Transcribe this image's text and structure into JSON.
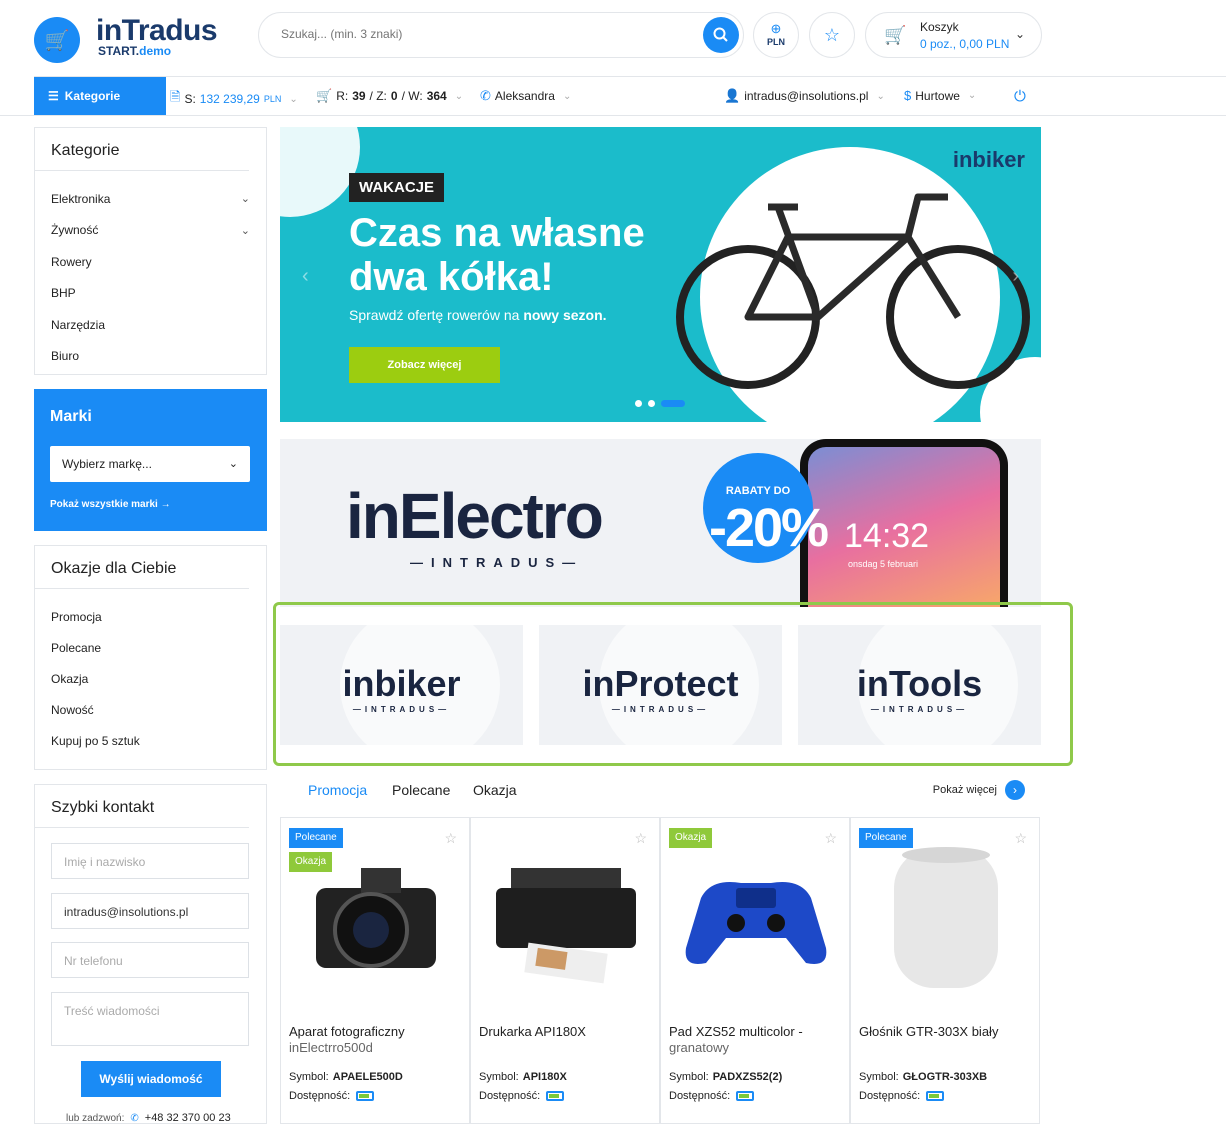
{
  "header": {
    "logo_main": "inTradus",
    "logo_sub_a": "START.",
    "logo_sub_b": "demo",
    "search_placeholder": "Szukaj... (min. 3 znaki)",
    "currency_label": "PLN",
    "cart": {
      "title": "Koszyk",
      "summary": "0 poz., 0,00 PLN"
    }
  },
  "subnav": {
    "categories_label": "Kategorie",
    "balance_prefix": "S:",
    "balance_value": "132 239,29",
    "balance_currency": "PLN",
    "orders_r": "R:",
    "orders_r_val": "39",
    "orders_z": " / Z:",
    "orders_z_val": "0",
    "orders_w": " / W:",
    "orders_w_val": "364",
    "user": "Aleksandra",
    "email": "intradus@insolutions.pl",
    "price_type": "Hurtowe"
  },
  "sidebar": {
    "categories_title": "Kategorie",
    "categories": [
      {
        "label": "Elektronika",
        "has_children": true
      },
      {
        "label": "Żywność",
        "has_children": true
      },
      {
        "label": "Rowery"
      },
      {
        "label": "BHP"
      },
      {
        "label": "Narzędzia"
      },
      {
        "label": "Biuro"
      }
    ],
    "brands_title": "Marki",
    "brands_select": "Wybierz markę...",
    "brands_all": "Pokaż wszystkie marki",
    "deals_title": "Okazje dla Ciebie",
    "deals": [
      "Promocja",
      "Polecane",
      "Okazja",
      "Nowość",
      "Kupuj po 5 sztuk"
    ],
    "contact_title": "Szybki kontakt",
    "contact_name_placeholder": "Imię i nazwisko",
    "contact_email_value": "intradus@insolutions.pl",
    "contact_phone_placeholder": "Nr telefonu",
    "contact_message_placeholder": "Treść wiadomości",
    "contact_send": "Wyślij wiadomość",
    "call_label": "lub zadzwoń:",
    "call_number": "+48 32 370 00 23"
  },
  "slider": {
    "tag": "WAKACJE",
    "headline_1": "Czas na własne",
    "headline_2": "dwa kółka!",
    "sub_a": "Sprawdź ofertę rowerów na ",
    "sub_b": "nowy sezon.",
    "button": "Zobacz więcej",
    "brand": "inbiker"
  },
  "electro": {
    "logo": "inElectro",
    "sub": "—INTRADUS—",
    "promo_top": "RABATY DO",
    "promo_value": "-20%",
    "phone_time": "14:32",
    "phone_date": "onsdag 5 februari"
  },
  "brand_tiles": [
    {
      "name": "inbiker",
      "sub": "—INTRADUS—"
    },
    {
      "name": "inProtect",
      "sub": "—INTRADUS—"
    },
    {
      "name": "inTools",
      "sub": "—INTRADUS—"
    }
  ],
  "product_tabs": {
    "tabs": [
      "Promocja",
      "Polecane",
      "Okazja"
    ],
    "more": "Pokaż więcej"
  },
  "products": [
    {
      "badges": [
        "Polecane",
        "Okazja"
      ],
      "name": "Aparat fotograficzny",
      "name2": "inElectrro500d",
      "symbol_label": "Symbol:",
      "symbol": "APAELE500D",
      "avail_label": "Dostępność:",
      "icon": "camera"
    },
    {
      "badges": [],
      "name": "Drukarka API180X",
      "name2": "",
      "symbol_label": "Symbol:",
      "symbol": "API180X",
      "avail_label": "Dostępność:",
      "icon": "printer"
    },
    {
      "badges": [
        "Okazja"
      ],
      "name": "Pad XZS52 multicolor -",
      "name2": "granatowy",
      "symbol_label": "Symbol:",
      "symbol": "PADXZS52(2)",
      "avail_label": "Dostępność:",
      "icon": "gamepad"
    },
    {
      "badges": [
        "Polecane"
      ],
      "name": "Głośnik GTR-303X biały",
      "name2": "",
      "symbol_label": "Symbol:",
      "symbol": "GŁOGTR-303XB",
      "avail_label": "Dostępność:",
      "icon": "speaker"
    }
  ],
  "colors": {
    "accent": "#1a8bf5",
    "green": "#8fc93a",
    "teal": "#1bbccb"
  }
}
